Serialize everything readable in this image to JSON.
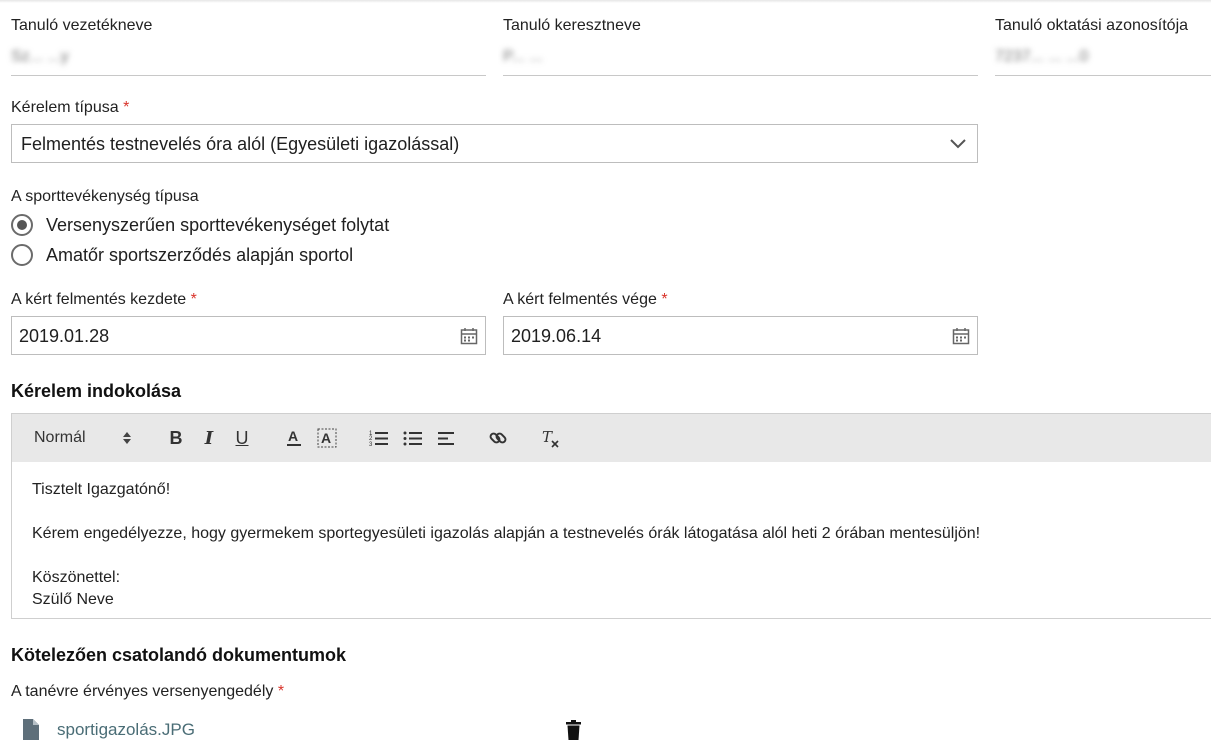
{
  "student": {
    "last_name_label": "Tanuló vezetékneve",
    "last_name_value": "Sz... ...y",
    "first_name_label": "Tanuló keresztneve",
    "first_name_value": "P... ...",
    "id_label": "Tanuló oktatási azonosítója",
    "id_value": "7237... ... ...0"
  },
  "request_type": {
    "label": "Kérelem típusa",
    "required_mark": "*",
    "value": "Felmentés testnevelés óra alól (Egyesületi igazolással)"
  },
  "sport_type": {
    "label": "A sporttevékenység típusa",
    "options": [
      {
        "label": "Versenyszerűen sporttevékenységet folytat",
        "selected": true
      },
      {
        "label": "Amatőr sportszerződés alapján sportol",
        "selected": false
      }
    ]
  },
  "dates": {
    "start_label": "A kért felmentés kezdete",
    "start_value": "2019.01.28",
    "end_label": "A kért felmentés vége",
    "end_value": "2019.06.14",
    "required_mark": "*"
  },
  "justification": {
    "heading": "Kérelem indokolása",
    "toolbar": {
      "format_value": "Normál",
      "icons": [
        "bold-icon",
        "italic-icon",
        "underline-icon",
        "font-color-icon",
        "background-color-icon",
        "ordered-list-icon",
        "bullet-list-icon",
        "align-icon",
        "link-icon",
        "clear-format-icon"
      ]
    },
    "lines": [
      "Tisztelt Igazgatónő!",
      "Kérem engedélyezze, hogy gyermekem sportegyesületi igazolás alapján a testnevelés órák látogatása alól heti 2 órában mentesüljön!",
      "Köszönettel:",
      "Szülő Neve"
    ]
  },
  "documents": {
    "heading": "Kötelezően csatolandó dokumentumok",
    "license_label": "A tanévre érvényes versenyengedély",
    "required_mark": "*",
    "file_name": "sportigazolás.JPG"
  },
  "colors": {
    "required": "#d9342b",
    "link": "#4a6d76",
    "toolbar_bg": "#e8e8e8"
  }
}
